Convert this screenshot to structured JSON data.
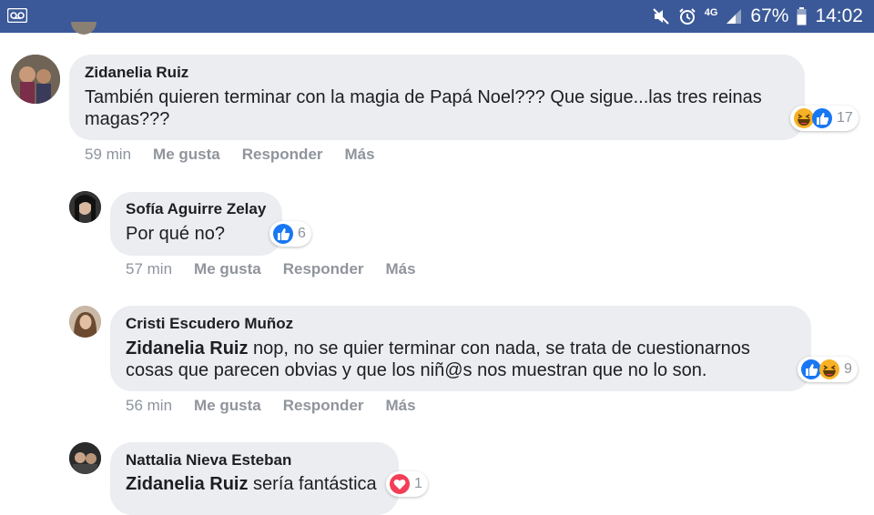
{
  "status_bar": {
    "battery": "67%",
    "time": "14:02",
    "network": "4G"
  },
  "colors": {
    "header_bg": "#3b5998",
    "bubble_bg": "#ebedf0",
    "like_blue": "#1877f2",
    "haha_yellow": "#f7b125",
    "love_red": "#f33e58"
  },
  "comments": [
    {
      "author": "Zidanelia Ruiz",
      "mention": "",
      "text": "También quieren terminar con la magia de Papá Noel??? Que sigue...las tres reinas magas???",
      "reactions": [
        "haha-icon",
        "like-icon"
      ],
      "reaction_count": "17",
      "time": "59 min",
      "like": "Me gusta",
      "reply": "Responder",
      "more": "Más"
    },
    {
      "author": "Sofía Aguirre Zelay",
      "mention": "",
      "text": "Por qué no?",
      "reactions": [
        "like-icon"
      ],
      "reaction_count": "6",
      "time": "57 min",
      "like": "Me gusta",
      "reply": "Responder",
      "more": "Más"
    },
    {
      "author": "Cristi Escudero Muñoz",
      "mention": "Zidanelia Ruiz",
      "text": "nop, no se quier terminar con nada, se trata de cuestionarnos cosas que parecen obvias y que los niñ@s nos muestran que no lo son.",
      "reactions": [
        "like-icon",
        "haha-icon"
      ],
      "reaction_count": "9",
      "time": "56 min",
      "like": "Me gusta",
      "reply": "Responder",
      "more": "Más"
    },
    {
      "author": "Nattalia Nieva Esteban",
      "mention": "Zidanelia Ruiz",
      "text": "sería fantástica",
      "reactions": [
        "love-icon"
      ],
      "reaction_count": "1",
      "time": "",
      "like": "",
      "reply": "",
      "more": ""
    }
  ]
}
